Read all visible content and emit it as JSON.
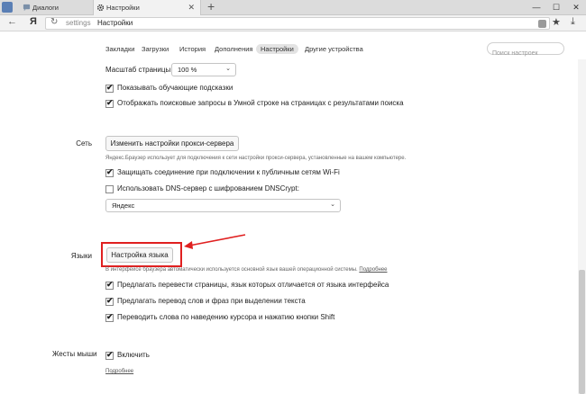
{
  "tabs": [
    {
      "label": "Диалоги"
    },
    {
      "label": "Настройки"
    }
  ],
  "window_controls": {
    "minimize": "—",
    "maximize": "☐",
    "close": "✕"
  },
  "address_bar": {
    "logo": "Я",
    "host": "settings",
    "page": "Настройки"
  },
  "nav": {
    "items": [
      "Закладки",
      "Загрузки",
      "История",
      "Дополнения",
      "Настройки",
      "Другие устройства"
    ],
    "active": "Настройки",
    "search_placeholder": "Поиск настроек"
  },
  "zoom": {
    "label": "Масштаб страницы:",
    "value": "100 %"
  },
  "checkboxes_top": [
    {
      "label": "Показывать обучающие подсказки",
      "checked": true
    },
    {
      "label": "Отображать поисковые запросы в Умной строке на страницах с результатами поиска",
      "checked": true
    }
  ],
  "network": {
    "title": "Сеть",
    "proxy_button": "Изменить настройки прокси-сервера",
    "proxy_note": "Яндекс.Браузер использует для подключения к сети настройки прокси-сервера, установленные на вашем компьютере.",
    "wifi_protect": {
      "label": "Защищать соединение при подключении к публичным сетям Wi-Fi",
      "checked": true
    },
    "dnscrypt": {
      "label": "Использовать DNS-сервер с шифрованием DNSCrypt:",
      "checked": false
    },
    "dns_select": "Яндекс"
  },
  "languages": {
    "title": "Языки",
    "button": "Настройка языка",
    "note": "В интерфейсе браузера автоматически используется основной язык вашей операционной системы.",
    "note_link": "Подробнее",
    "options": [
      {
        "label": "Предлагать перевести страницы, язык которых отличается от языка интерфейса",
        "checked": true
      },
      {
        "label": "Предлагать перевод слов и фраз при выделении текста",
        "checked": true
      },
      {
        "label": "Переводить слова по наведению курсора и нажатию кнопки Shift",
        "checked": true
      }
    ]
  },
  "gestures": {
    "title": "Жесты мыши",
    "enable": {
      "label": "Включить",
      "checked": true
    },
    "more_link": "Подробнее"
  },
  "colors": {
    "highlight": "#e02020",
    "arrow": "#e02020"
  }
}
